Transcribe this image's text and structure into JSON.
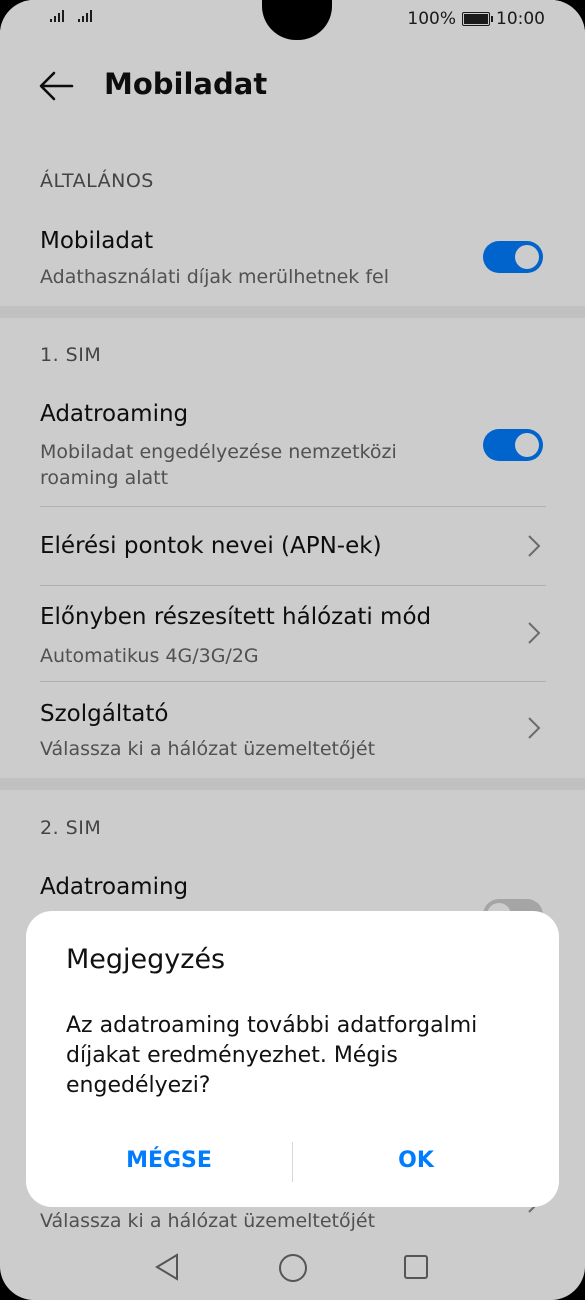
{
  "status_bar": {
    "battery": "100%",
    "time": "10:00"
  },
  "header": {
    "title": "Mobiladat"
  },
  "general": {
    "label": "ÁLTALÁNOS",
    "mobile_data": {
      "title": "Mobiladat",
      "subtitle": "Adathasználati díjak merülhetnek fel",
      "enabled": true
    }
  },
  "sim1": {
    "label": "1. SIM",
    "roaming": {
      "title": "Adatroaming",
      "subtitle_line1": "Mobiladat engedélyezése nemzetközi",
      "subtitle_line2": "roaming alatt",
      "enabled": true
    },
    "apn": {
      "title": "Elérési pontok nevei (APN-ek)"
    },
    "network_mode": {
      "title": "Előnyben részesített hálózati mód",
      "subtitle": "Automatikus 4G/3G/2G"
    },
    "provider": {
      "title": "Szolgáltató",
      "subtitle": "Válassza ki a hálózat üzemeltetőjét"
    }
  },
  "sim2": {
    "label": "2. SIM",
    "roaming": {
      "title": "Adatroaming",
      "enabled": false
    },
    "provider": {
      "subtitle": "Válassza ki a hálózat üzemeltetőjét"
    }
  },
  "dialog": {
    "title": "Megjegyzés",
    "message": "Az adatroaming további adatforgalmi díjakat eredményezhet. Mégis engedélyezi?",
    "cancel_label": "MÉGSE",
    "ok_label": "OK"
  },
  "colors": {
    "accent": "#007dff",
    "toggle_off": "#cfcfcf"
  },
  "icons": {
    "back": "arrow-left-icon",
    "chevron": "chevron-right-icon",
    "nav_back": "triangle-back-icon",
    "nav_home": "circle-home-icon",
    "nav_recents": "square-recents-icon"
  }
}
